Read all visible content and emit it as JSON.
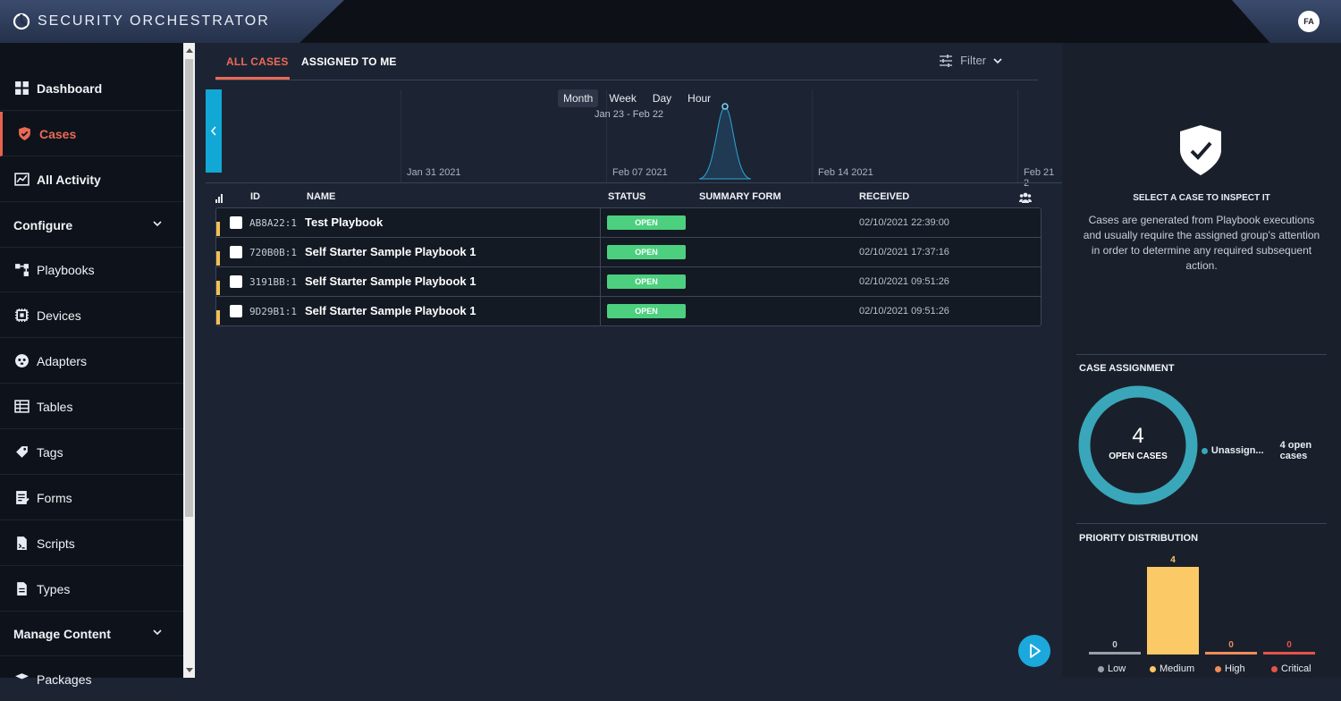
{
  "app": {
    "title": "SECURITY ORCHESTRATOR",
    "avatar": "FA"
  },
  "sidebar": {
    "items": [
      {
        "label": "Dashboard"
      },
      {
        "label": "Cases"
      },
      {
        "label": "All Activity"
      },
      {
        "label": "Configure"
      },
      {
        "label": "Playbooks"
      },
      {
        "label": "Devices"
      },
      {
        "label": "Adapters"
      },
      {
        "label": "Tables"
      },
      {
        "label": "Tags"
      },
      {
        "label": "Forms"
      },
      {
        "label": "Scripts"
      },
      {
        "label": "Types"
      },
      {
        "label": "Manage Content"
      },
      {
        "label": "Packages"
      }
    ]
  },
  "tabs": {
    "all": "ALL CASES",
    "mine": "ASSIGNED TO ME",
    "filter": "Filter"
  },
  "timeline": {
    "ranges": [
      "Month",
      "Week",
      "Day",
      "Hour"
    ],
    "selected": "Month",
    "range_label": "Jan 23 - Feb 22",
    "ticks": [
      "Jan 31 2021",
      "Feb 07 2021",
      "Feb 14 2021",
      "Feb 21 2"
    ]
  },
  "table": {
    "headers": {
      "id": "ID",
      "name": "NAME",
      "status": "STATUS",
      "summary": "SUMMARY FORM",
      "received": "RECEIVED"
    },
    "rows": [
      {
        "id": "AB8A22:1",
        "name": "Test Playbook",
        "status": "OPEN",
        "received": "02/10/2021 22:39:00"
      },
      {
        "id": "720B0B:1",
        "name": "Self Starter Sample Playbook 1",
        "status": "OPEN",
        "received": "02/10/2021 17:37:16"
      },
      {
        "id": "3191BB:1",
        "name": "Self Starter Sample Playbook 1",
        "status": "OPEN",
        "received": "02/10/2021 09:51:26"
      },
      {
        "id": "9D29B1:1",
        "name": "Self Starter Sample Playbook 1",
        "status": "OPEN",
        "received": "02/10/2021 09:51:26"
      }
    ]
  },
  "inspect": {
    "title": "SELECT A CASE TO INSPECT IT",
    "description": "Cases are generated from Playbook executions and usually require the assigned group's attention in order to determine any required subsequent action."
  },
  "assignment": {
    "title": "CASE ASSIGNMENT",
    "count": "4",
    "count_label": "OPEN CASES",
    "legend_label": "Unassign...",
    "legend_count": "4 open cases",
    "color": "#3aa6b9"
  },
  "priority": {
    "title": "PRIORITY DISTRIBUTION",
    "bars": [
      {
        "label": "Low",
        "value": 0,
        "color": "#9aa0a8"
      },
      {
        "label": "Medium",
        "value": 4,
        "color": "#fbc965"
      },
      {
        "label": "High",
        "value": 0,
        "color": "#f08c5a"
      },
      {
        "label": "Critical",
        "value": 0,
        "color": "#e8524a"
      }
    ]
  }
}
